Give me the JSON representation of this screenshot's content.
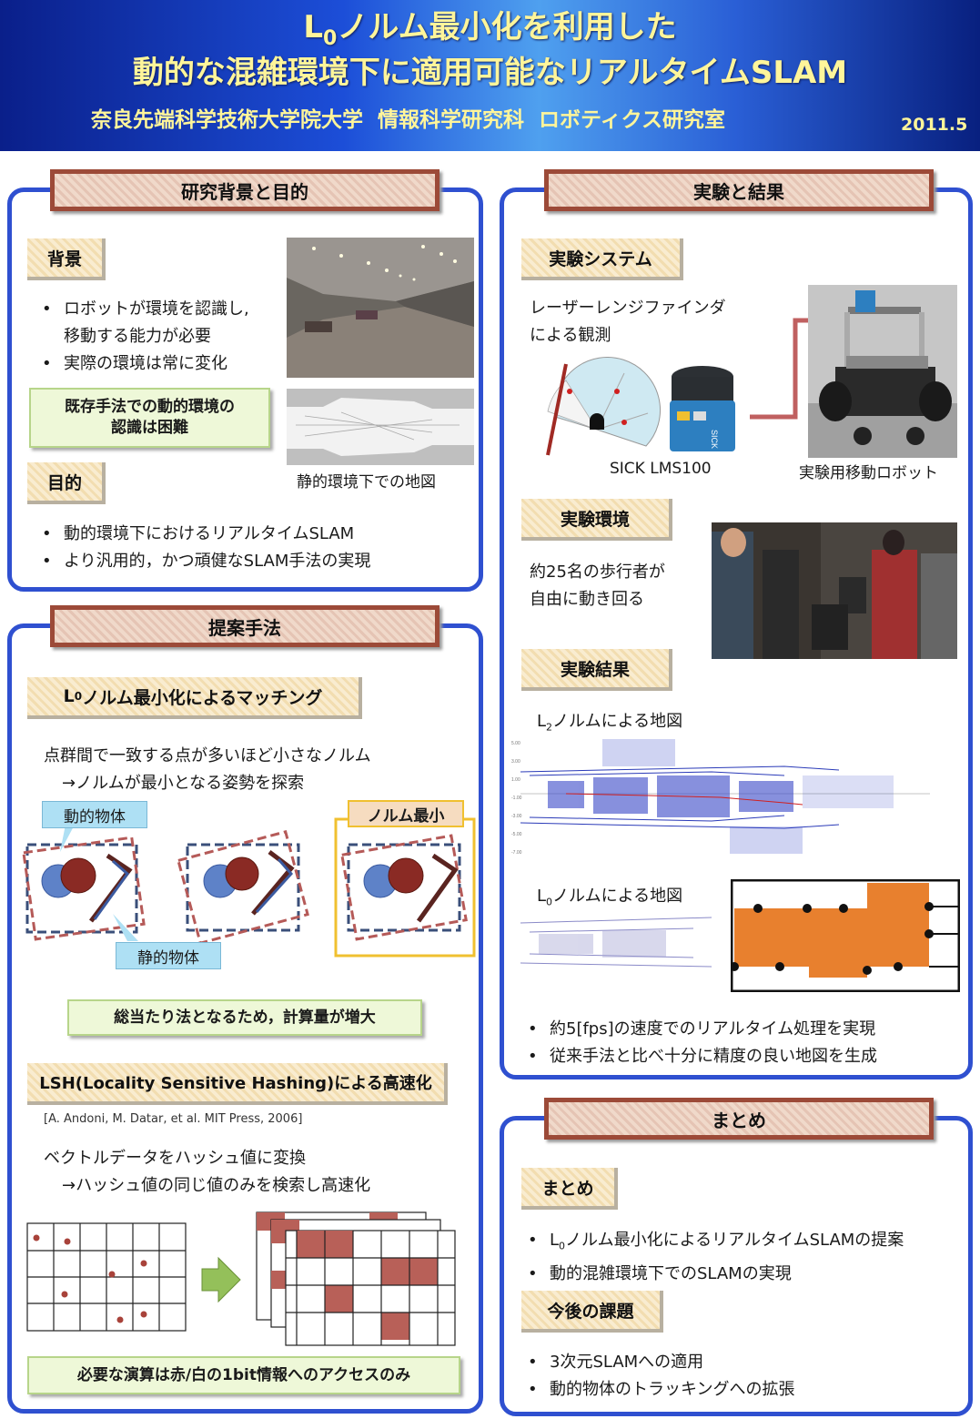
{
  "header": {
    "title_line1_pre": "L",
    "title_line1_sub": "0",
    "title_line1_post": "ノルム最小化を利用した",
    "title_line2": "動的な混雑環境下に適用可能なリアルタイムSLAM",
    "affiliation": "奈良先端科学技術大学院大学  情報科学研究科  ロボティクス研究室",
    "date": "2011.5"
  },
  "background": {
    "section_title": "研究背景と目的",
    "bg_label": "背景",
    "bg_items": [
      "ロボットが環境を認識し,",
      "移動する能力が必要",
      "実際の環境は常に変化"
    ],
    "note": [
      "既存手法での動的環境の",
      "認識は困難"
    ],
    "goal_label": "目的",
    "goal_items": [
      "動的環境下におけるリアルタイムSLAM",
      "より汎用的，かつ頑健なSLAM手法の実現"
    ],
    "map_caption": "静的環境下での地図"
  },
  "method": {
    "section_title": "提案手法",
    "l0_label_pre": "L",
    "l0_label_sub": "0",
    "l0_label_post": "ノルム最小化によるマッチング",
    "l0_text1": "点群間で一致する点が多いほど小さなノルム",
    "l0_text2": "→ノルムが最小となる姿勢を探索",
    "dynamic_label": "動的物体",
    "static_label": "静的物体",
    "min_label": "ノルム最小",
    "cost_note": "総当たり法となるため，計算量が増大",
    "lsh_label": "LSH(Locality Sensitive Hashing)による高速化",
    "lsh_ref": "[A. Andoni, M. Datar, et al. MIT Press, 2006]",
    "lsh_text1": "ベクトルデータをハッシュ値に変換",
    "lsh_text2": "→ハッシュ値の同じ値のみを検索し高速化",
    "lsh_note": "必要な演算は赤/白の1bit情報へのアクセスのみ"
  },
  "experiment": {
    "section_title": "実験と結果",
    "system_label": "実験システム",
    "system_text": [
      "レーザーレンジファインダ",
      "による観測"
    ],
    "sensor_caption": "SICK LMS100",
    "robot_caption": "実験用移動ロボット",
    "env_label": "実験環境",
    "env_text": [
      "約25名の歩行者が",
      "自由に動き回る"
    ],
    "result_label": "実験結果",
    "l2_map_pre": "L",
    "l2_map_sub": "2",
    "l2_map_post": "ノルムによる地図",
    "l0_map_pre": "L",
    "l0_map_sub": "0",
    "l0_map_post": "ノルムによる地図",
    "result_items": [
      "約5[fps]の速度でのリアルタイム処理を実現",
      "従来手法と比べ十分に精度の良い地図を生成"
    ]
  },
  "summary": {
    "section_title": "まとめ",
    "summary_label": "まとめ",
    "summary_item1_pre": "L",
    "summary_item1_sub": "0",
    "summary_item1_post": "ノルム最小化によるリアルタイムSLAMの提案",
    "summary_item2": "動的混雑環境下でのSLAMの実現",
    "future_label": "今後の課題",
    "future_items": [
      "3次元SLAMへの適用",
      "動的物体のトラッキングへの拡張"
    ]
  },
  "colors": {
    "header_blue": "#1c4ed8",
    "title_yellow": "#fff59a",
    "panel_border": "#2f50d0",
    "section_border": "#9c4a38",
    "marker_red": "#a8423a",
    "map_orange": "#e8802e"
  }
}
